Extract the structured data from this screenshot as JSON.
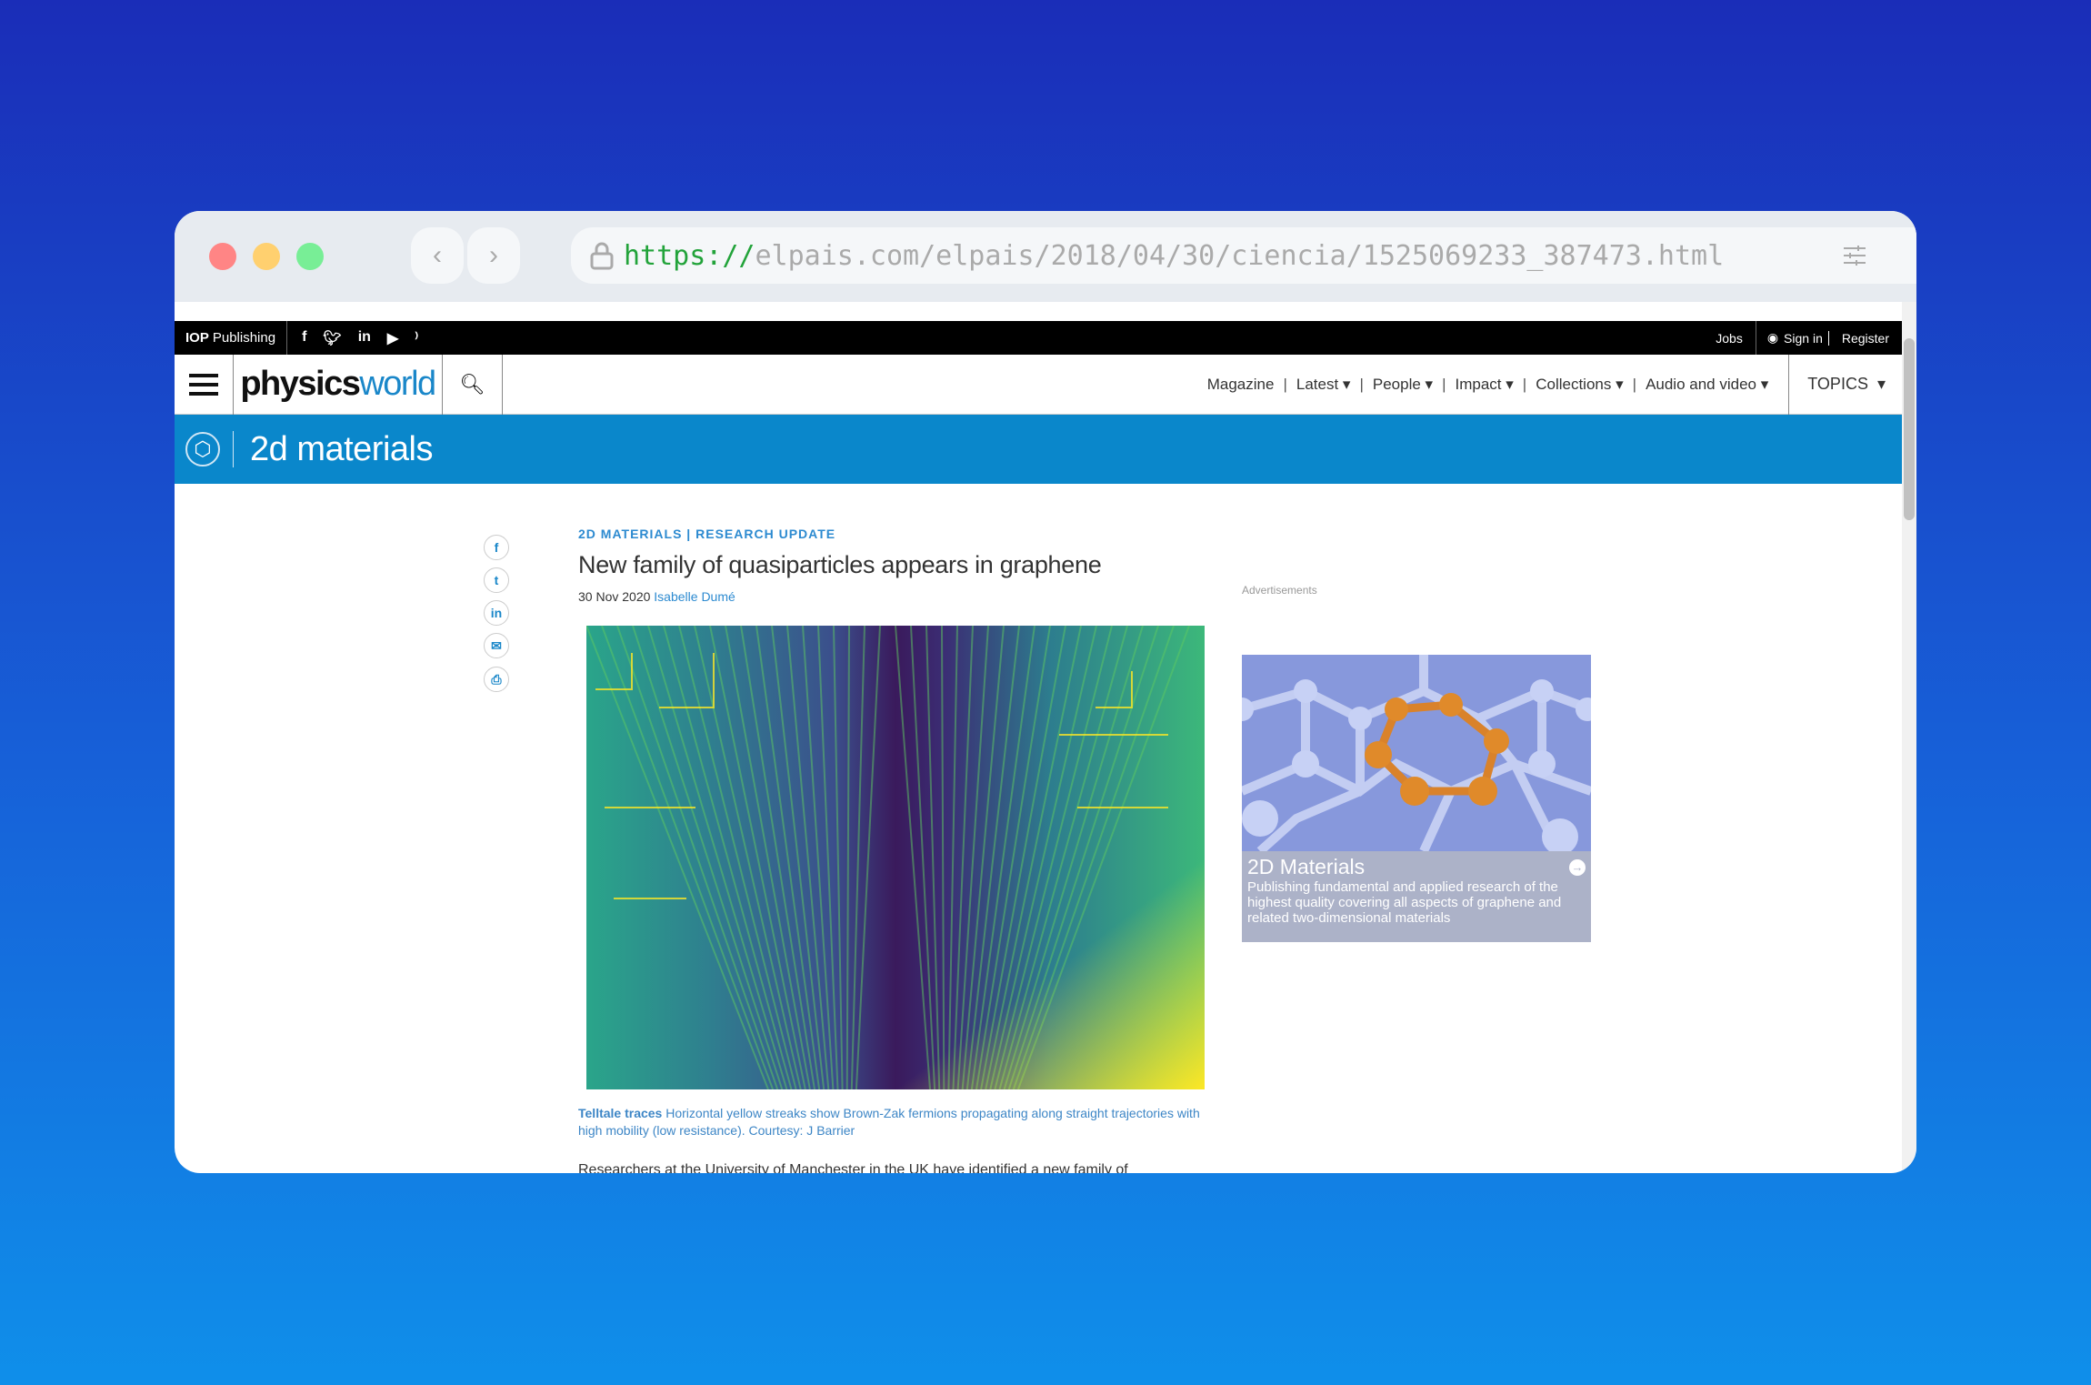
{
  "browser": {
    "url_protocol": "https://",
    "url_rest": "elpais.com/elpais/2018/04/30/ciencia/1525069233_387473.html",
    "colors": {
      "close": "#ff8585",
      "minimize": "#ffd06f",
      "maximize": "#78ee96"
    }
  },
  "topbar": {
    "publisher_bold": "IOP",
    "publisher_rest": "Publishing",
    "social": [
      "facebook-icon",
      "twitter-icon",
      "linkedin-icon",
      "youtube-icon",
      "rss-icon"
    ],
    "jobs": "Jobs",
    "sign_in": "Sign in",
    "register": "Register"
  },
  "nav": {
    "logo_a": "physics",
    "logo_b": "world",
    "items": [
      {
        "label": "Magazine"
      },
      {
        "label": "Latest"
      },
      {
        "label": "People"
      },
      {
        "label": "Impact"
      },
      {
        "label": "Collections"
      },
      {
        "label": "Audio and video"
      }
    ],
    "topics": "TOPICS"
  },
  "banner": {
    "title": "2d materials",
    "color": "#0a87cb"
  },
  "article": {
    "category": "2D MATERIALS",
    "type": "RESEARCH UPDATE",
    "title": "New family of quasiparticles appears in graphene",
    "date": "30 Nov 2020",
    "author": "Isabelle Dumé",
    "caption_bold": "Telltale traces",
    "caption": "Horizontal yellow streaks show Brown-Zak fermions propagating along straight trajectories with high mobility (low resistance). Courtesy: J Barrier",
    "body_start": "Researchers at the University of Manchester in the UK have identified a new family of"
  },
  "share": [
    "facebook-icon",
    "twitter-icon",
    "linkedin-icon",
    "email-icon",
    "print-icon"
  ],
  "ad": {
    "label": "Advertisements",
    "title": "2D Materials",
    "description": "Publishing fundamental and applied research of the highest quality covering all aspects of graphene and related two-dimensional materials"
  }
}
